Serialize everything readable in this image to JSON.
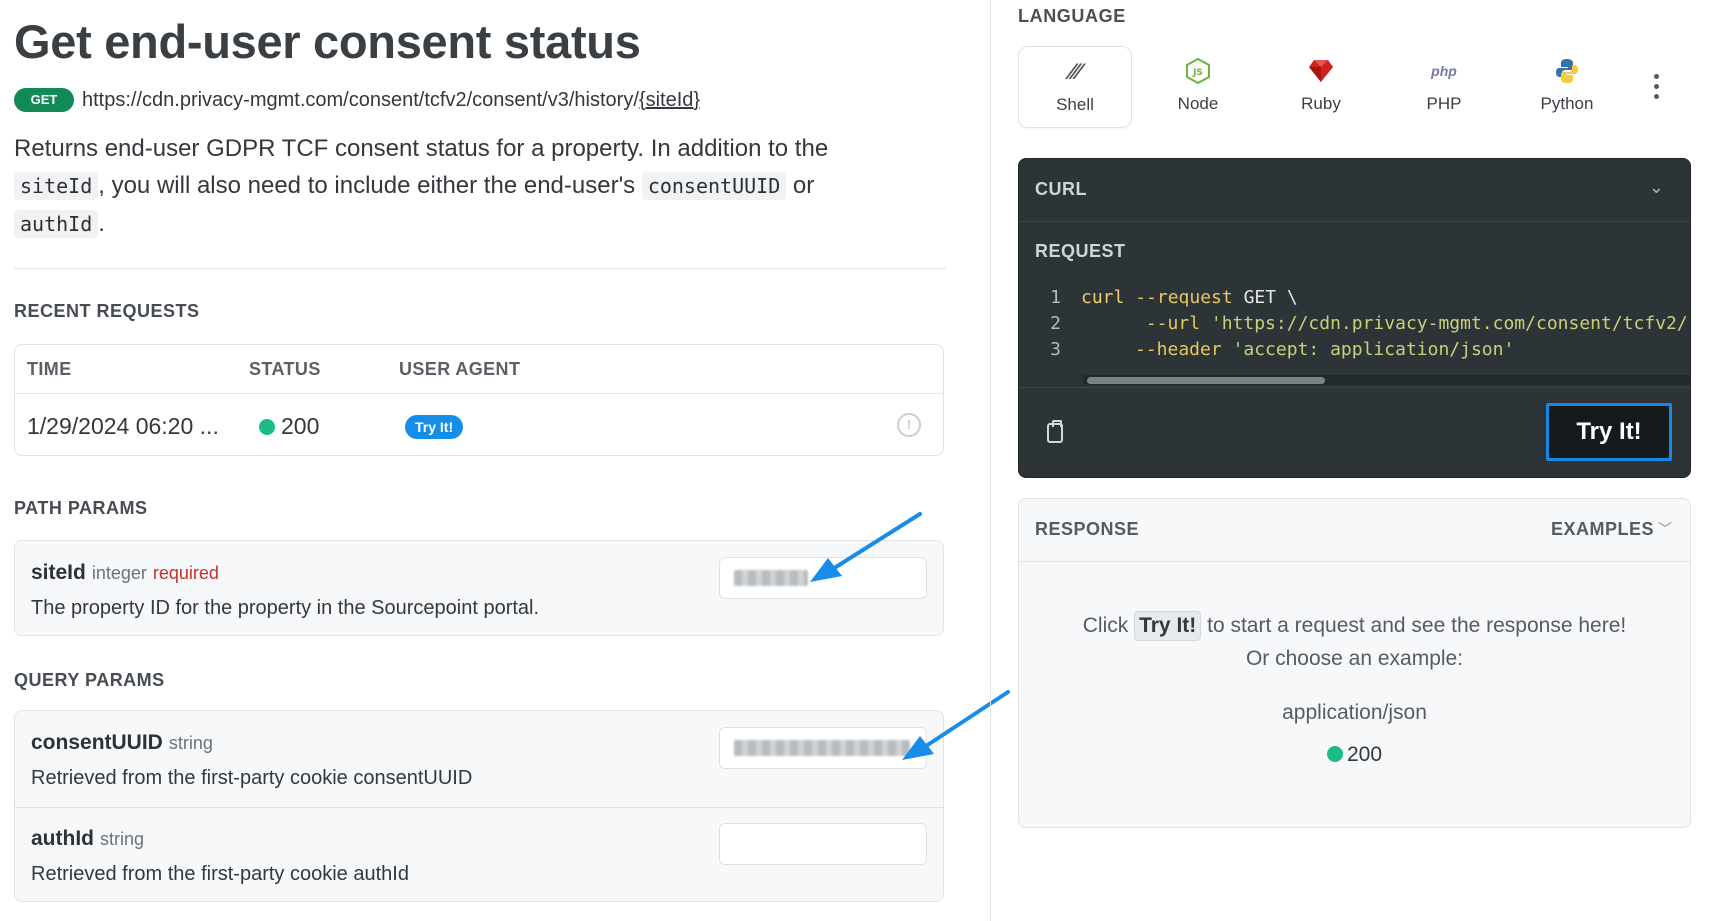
{
  "header": {
    "title": "Get end-user consent status",
    "method": "GET",
    "url_prefix": "https://cdn.privacy-mgmt.com/consent/tcfv2/consent/v3/history/",
    "url_param": "{siteId}"
  },
  "description": {
    "part1": "Returns end-user GDPR TCF consent status for a property. In addition to the ",
    "code1": "siteId",
    "part2": ", you will also need to include either the end-user's ",
    "code2": "consentUUID",
    "part3": " or ",
    "code3": "authId",
    "part4": "."
  },
  "recent_requests": {
    "section_label": "RECENT REQUESTS",
    "columns": [
      "TIME",
      "STATUS",
      "USER AGENT"
    ],
    "rows": [
      {
        "time": "1/29/2024 06:20 ...",
        "status": "200",
        "status_color": "#1bbc84",
        "user_agent": "Try It!"
      }
    ]
  },
  "path_params": {
    "section_label": "PATH PARAMS",
    "items": [
      {
        "name": "siteId",
        "type": "integer",
        "required": "required",
        "description": "The property ID for the property in the Sourcepoint portal."
      }
    ]
  },
  "query_params": {
    "section_label": "QUERY PARAMS",
    "items": [
      {
        "name": "consentUUID",
        "type": "string",
        "description": "Retrieved from the first-party cookie consentUUID"
      },
      {
        "name": "authId",
        "type": "string",
        "description": "Retrieved from the first-party cookie authId"
      }
    ]
  },
  "language": {
    "label": "LANGUAGE",
    "tabs": [
      {
        "name": "Shell",
        "icon": "shell-icon",
        "active": true
      },
      {
        "name": "Node",
        "icon": "nodejs-icon",
        "active": false
      },
      {
        "name": "Ruby",
        "icon": "ruby-icon",
        "active": false
      },
      {
        "name": "PHP",
        "icon": "php-icon",
        "active": false
      },
      {
        "name": "Python",
        "icon": "python-icon",
        "active": false
      }
    ]
  },
  "code_panel": {
    "title": "CURL",
    "request_label": "REQUEST",
    "lines": [
      {
        "num": "1",
        "cmd": "curl",
        "flag": "--request",
        "rest": " GET \\"
      },
      {
        "num": "2",
        "flag": "--url",
        "str": "'https://cdn.privacy-mgmt.com/consent/tcfv2/"
      },
      {
        "num": "3",
        "flag": "--header",
        "str": "'accept: application/json'"
      }
    ],
    "try_it_label": "Try It!"
  },
  "response": {
    "label": "RESPONSE",
    "examples_label": "EXAMPLES",
    "click": "Click",
    "chip": "Try It!",
    "line1_rest": "to start a request and see the response here!",
    "line2": "Or choose an example:",
    "mime": "application/json",
    "status": "200"
  },
  "colors": {
    "accent": "#1a86e8",
    "success": "#1bbc84",
    "get_badge": "#128a55",
    "required": "#c0352b",
    "code_bg": "#2d3438"
  }
}
